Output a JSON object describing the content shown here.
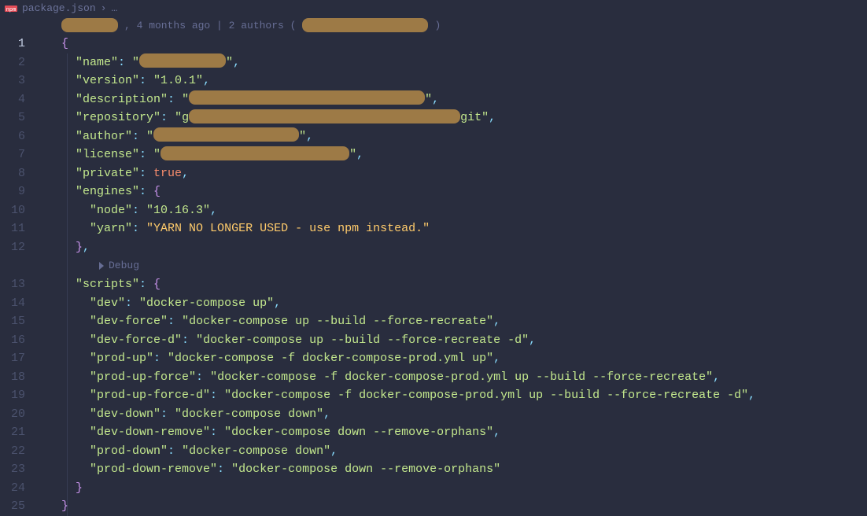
{
  "breadcrumb": {
    "file": "package.json",
    "sep": "›",
    "more": "…"
  },
  "codelens": {
    "blame_suffix": ", 4 months ago | 2 authors (",
    "blame_close": ")",
    "debug": "Debug"
  },
  "gutter": {
    "lines": [
      "1",
      "2",
      "3",
      "4",
      "5",
      "6",
      "7",
      "8",
      "9",
      "10",
      "11",
      "12",
      "13",
      "14",
      "15",
      "16",
      "17",
      "18",
      "19",
      "20",
      "21",
      "22",
      "23",
      "24",
      "25"
    ]
  },
  "json": {
    "name_key": "\"name\"",
    "name_val_prefix": "\"",
    "name_val_suffix": "\"",
    "version_key": "\"version\"",
    "version_val": "\"1.0.1\"",
    "description_key": "\"description\"",
    "desc_prefix": "\"",
    "desc_suffix": "\"",
    "repository_key": "\"repository\"",
    "repo_prefix": "\"g",
    "repo_suffix": "git\"",
    "author_key": "\"author\"",
    "author_prefix": "\"",
    "author_suffix": "\"",
    "license_key": "\"license\"",
    "license_prefix": "\"",
    "license_suffix": "\"",
    "private_key": "\"private\"",
    "private_val": "true",
    "engines_key": "\"engines\"",
    "node_key": "\"node\"",
    "node_val": "\"10.16.3\"",
    "yarn_key": "\"yarn\"",
    "yarn_val": "\"YARN NO LONGER USED - use npm instead.\"",
    "scripts_key": "\"scripts\"",
    "scripts": {
      "dev": {
        "k": "\"dev\"",
        "v": "\"docker-compose up\""
      },
      "dev_force": {
        "k": "\"dev-force\"",
        "v": "\"docker-compose up --build --force-recreate\""
      },
      "dev_force_d": {
        "k": "\"dev-force-d\"",
        "v": "\"docker-compose up --build --force-recreate -d\""
      },
      "prod_up": {
        "k": "\"prod-up\"",
        "v": "\"docker-compose -f docker-compose-prod.yml up\""
      },
      "prod_up_force": {
        "k": "\"prod-up-force\"",
        "v": "\"docker-compose -f docker-compose-prod.yml up --build --force-recreate\""
      },
      "prod_up_force_d": {
        "k": "\"prod-up-force-d\"",
        "v": "\"docker-compose -f docker-compose-prod.yml up --build --force-recreate -d\""
      },
      "dev_down": {
        "k": "\"dev-down\"",
        "v": "\"docker-compose down\""
      },
      "dev_down_remove": {
        "k": "\"dev-down-remove\"",
        "v": "\"docker-compose down --remove-orphans\""
      },
      "prod_down": {
        "k": "\"prod-down\"",
        "v": "\"docker-compose down\""
      },
      "prod_down_remove": {
        "k": "\"prod-down-remove\"",
        "v": "\"docker-compose down --remove-orphans\""
      }
    }
  }
}
